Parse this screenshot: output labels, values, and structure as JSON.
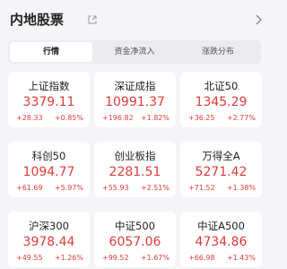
{
  "header": {
    "title": "内地股票"
  },
  "tabs": [
    {
      "label": "行情",
      "active": true
    },
    {
      "label": "资金净流入",
      "active": false
    },
    {
      "label": "涨跌分布",
      "active": false
    }
  ],
  "indices": [
    {
      "name": "上证指数",
      "value": "3379.11",
      "change": "+28.33",
      "pct": "+0.85%"
    },
    {
      "name": "深证成指",
      "value": "10991.37",
      "change": "+196.82",
      "pct": "+1.82%"
    },
    {
      "name": "北证50",
      "value": "1345.29",
      "change": "+36.25",
      "pct": "+2.77%"
    },
    {
      "name": "科创50",
      "value": "1094.77",
      "change": "+61.69",
      "pct": "+5.97%"
    },
    {
      "name": "创业板指",
      "value": "2281.51",
      "change": "+55.93",
      "pct": "+2.51%"
    },
    {
      "name": "万得全A",
      "value": "5271.42",
      "change": "+71.52",
      "pct": "+1.38%"
    },
    {
      "name": "沪深300",
      "value": "3978.44",
      "change": "+49.55",
      "pct": "+1.26%"
    },
    {
      "name": "中证500",
      "value": "6057.06",
      "change": "+99.52",
      "pct": "+1.67%"
    },
    {
      "name": "中证A500",
      "value": "4734.86",
      "change": "+66.98",
      "pct": "+1.43%"
    }
  ],
  "colors": {
    "up": "#e03b3b",
    "background": "#f5f5f7",
    "card": "#ffffff"
  },
  "icons": {
    "share": "share-icon",
    "chevron": "chevron-right-icon"
  }
}
